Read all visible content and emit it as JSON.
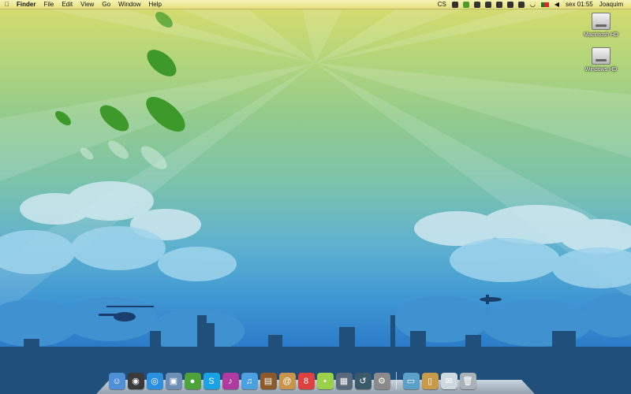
{
  "menubar": {
    "apple_icon": "apple-icon",
    "app_name": "Finder",
    "menus": [
      "File",
      "Edit",
      "View",
      "Go",
      "Window",
      "Help"
    ],
    "status_text_cs": "CS",
    "clock": "sex 01:55",
    "user": "Joaquim"
  },
  "desktop": {
    "drives": [
      "Macintosh HD",
      "Windows HD"
    ]
  },
  "dock": {
    "apps": [
      {
        "name": "finder-icon",
        "color": "#4e8fd6",
        "glyph": "☺"
      },
      {
        "name": "dashboard-icon",
        "color": "#3a3a3a",
        "glyph": "◉"
      },
      {
        "name": "safari-icon",
        "color": "#2c8fe0",
        "glyph": "◎"
      },
      {
        "name": "preview-icon",
        "color": "#6d8fb5",
        "glyph": "▣"
      },
      {
        "name": "adium-icon",
        "color": "#4da23a",
        "glyph": "●"
      },
      {
        "name": "skype-icon",
        "color": "#1aa3e4",
        "glyph": "S"
      },
      {
        "name": "itunes-eq-icon",
        "color": "#b03aa0",
        "glyph": "♪"
      },
      {
        "name": "itunes-icon",
        "color": "#4aa0e0",
        "glyph": "♫"
      },
      {
        "name": "iphoto-icon",
        "color": "#8a5a2a",
        "glyph": "▤"
      },
      {
        "name": "address-book-icon",
        "color": "#c9954a",
        "glyph": "@"
      },
      {
        "name": "ical-icon",
        "color": "#e04040",
        "glyph": "8"
      },
      {
        "name": "messages-icon",
        "color": "#9ad04a",
        "glyph": "•"
      },
      {
        "name": "spaces-icon",
        "color": "#5a6a7a",
        "glyph": "▦"
      },
      {
        "name": "time-machine-icon",
        "color": "#3a5a6a",
        "glyph": "↺"
      },
      {
        "name": "system-preferences-icon",
        "color": "#8a8a8a",
        "glyph": "⚙"
      }
    ],
    "stacks": [
      {
        "name": "picture-stack-icon",
        "color": "#5aa0c8",
        "glyph": "▭"
      },
      {
        "name": "documents-stack-icon",
        "color": "#c89a4a",
        "glyph": "▯"
      },
      {
        "name": "mail-stack-icon",
        "color": "#d0d8e0",
        "glyph": "✉"
      },
      {
        "name": "trash-icon",
        "color": "#a8b0b8",
        "glyph": "🗑"
      }
    ]
  }
}
